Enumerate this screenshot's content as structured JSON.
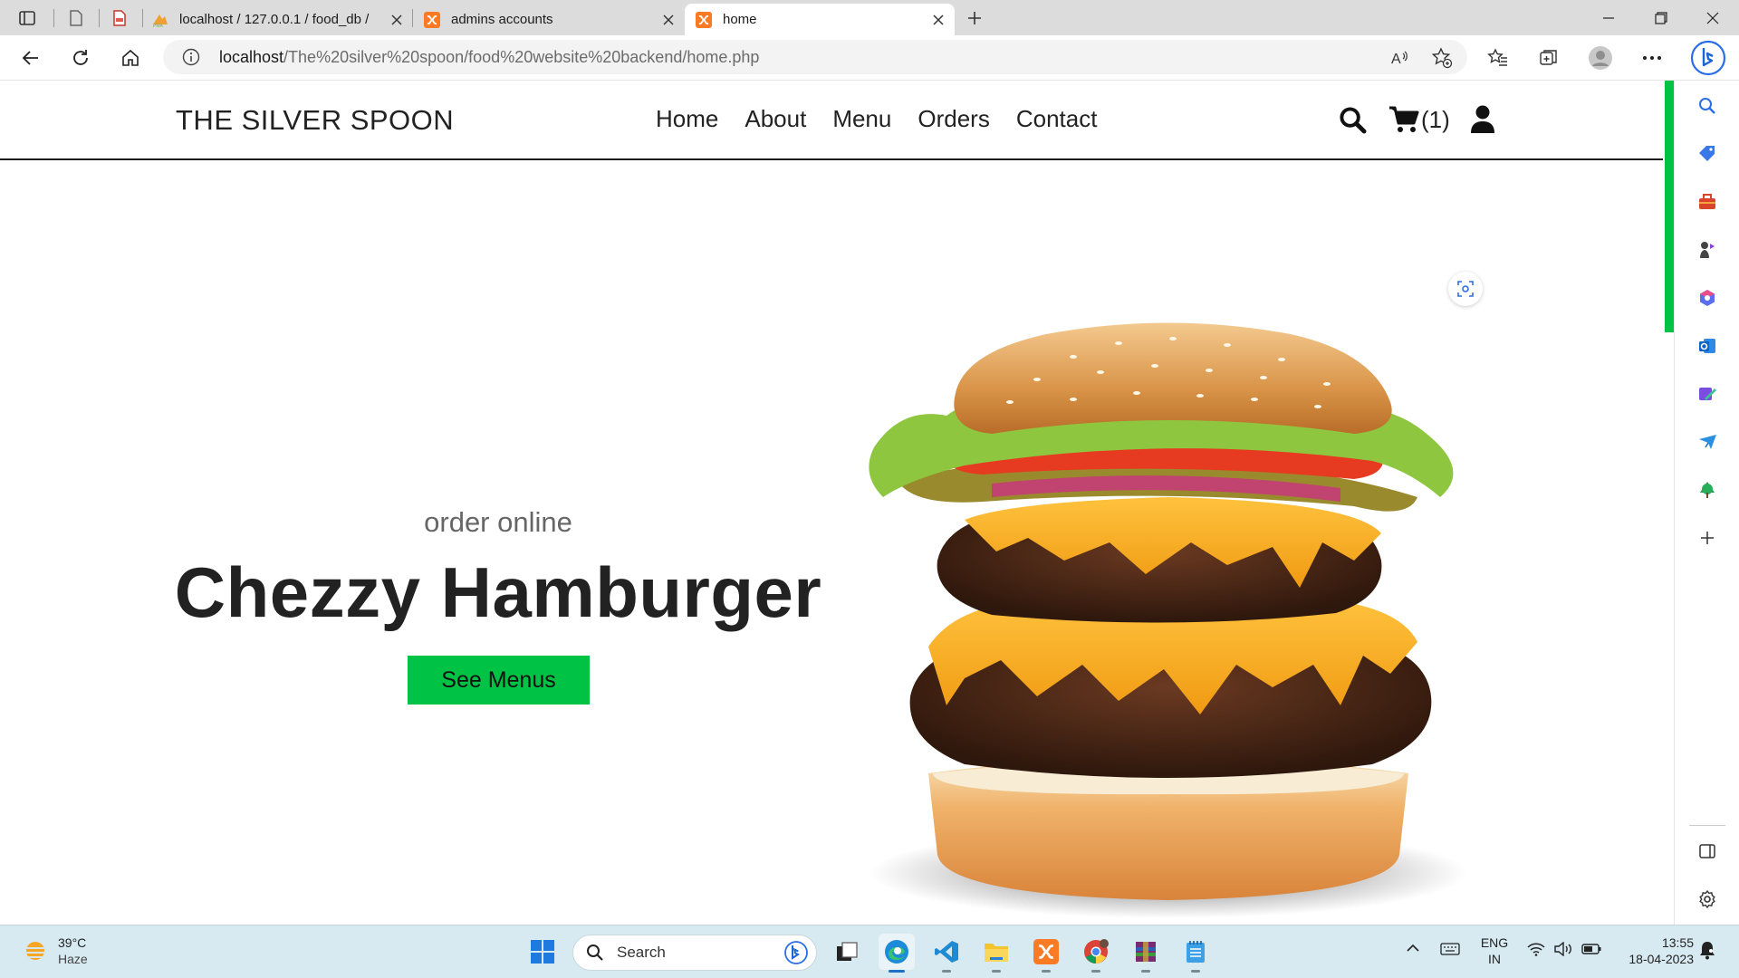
{
  "browser": {
    "tabs": [
      {
        "title": "localhost / 127.0.0.1 / food_db / ",
        "favicon": "phpmyadmin-icon",
        "active": false
      },
      {
        "title": "admins accounts",
        "favicon": "xampp-icon",
        "active": false
      },
      {
        "title": "home",
        "favicon": "xampp-icon",
        "active": true
      }
    ],
    "url_host": "localhost",
    "url_path": "/The%20silver%20spoon/food%20website%20backend/home.php"
  },
  "site": {
    "logo": "THE SILVER SPOON",
    "nav": [
      "Home",
      "About",
      "Menu",
      "Orders",
      "Contact"
    ],
    "cart_count": "(1)",
    "hero": {
      "subtitle": "order online",
      "title": "Chezzy Hamburger",
      "button": "See Menus"
    },
    "accent_color": "#00c244"
  },
  "taskbar": {
    "weather_temp": "39°C",
    "weather_desc": "Haze",
    "search_label": "Search",
    "lang_top": "ENG",
    "lang_bottom": "IN",
    "time": "13:55",
    "date": "18-04-2023"
  }
}
